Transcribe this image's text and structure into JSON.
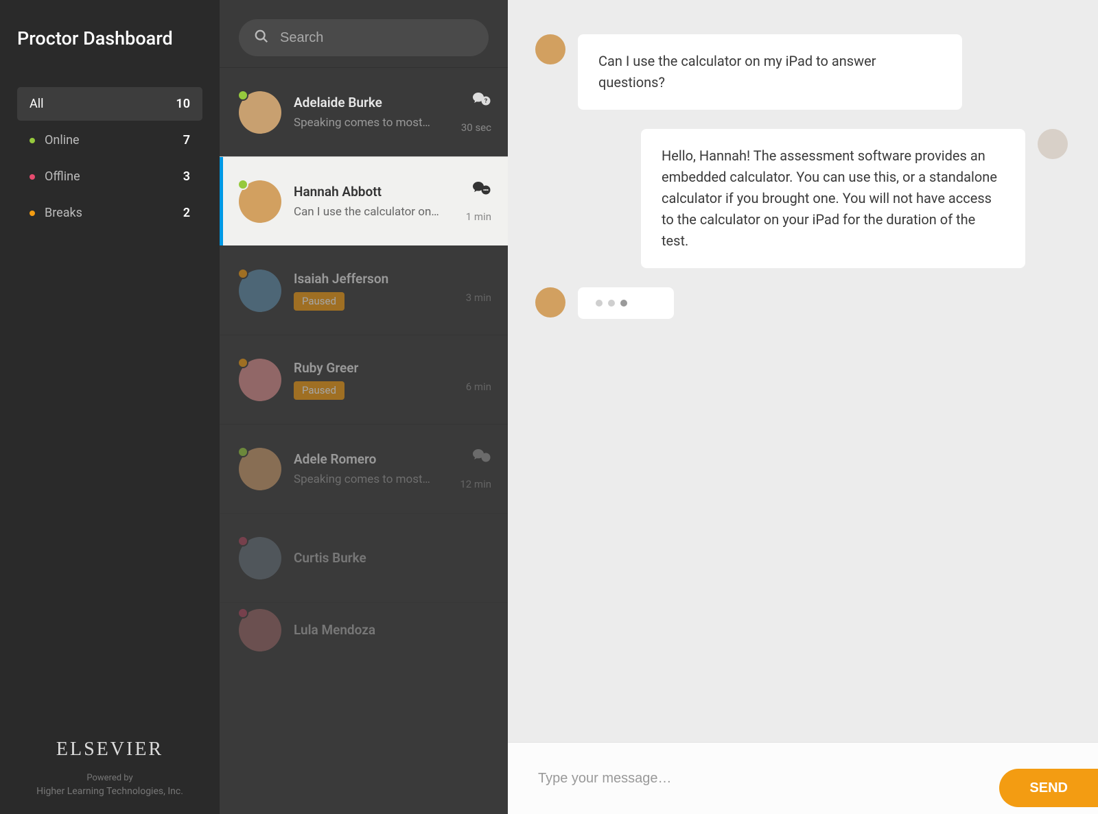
{
  "sidebar": {
    "title": "Proctor Dashboard",
    "filters": [
      {
        "label": "All",
        "count": "10",
        "status": "all",
        "active": true
      },
      {
        "label": "Online",
        "count": "7",
        "status": "online",
        "active": false
      },
      {
        "label": "Offline",
        "count": "3",
        "status": "offline",
        "active": false
      },
      {
        "label": "Breaks",
        "count": "2",
        "status": "break",
        "active": false
      }
    ],
    "brand": "ELSEVIER",
    "powered": "Powered by",
    "company": "Higher Learning Technologies, Inc."
  },
  "search": {
    "placeholder": "Search"
  },
  "students": [
    {
      "name": "Adelaide Burke",
      "preview": "Speaking comes to most…",
      "time": "30 sec",
      "status": "online",
      "chat": "question",
      "avatarColor": "#c8a070"
    },
    {
      "name": "Hannah Abbott",
      "preview": "Can I use the calculator on…",
      "time": "1 min",
      "status": "online",
      "chat": "active",
      "avatarColor": "#d2a060",
      "selected": true
    },
    {
      "name": "Isaiah Jefferson",
      "badge": "Paused",
      "time": "3 min",
      "status": "break",
      "avatarColor": "#5d8aa8"
    },
    {
      "name": "Ruby Greer",
      "badge": "Paused",
      "time": "6 min",
      "status": "break",
      "avatarColor": "#d98c8c"
    },
    {
      "name": "Adele Romero",
      "preview": "Speaking comes to most…",
      "time": "12 min",
      "status": "online",
      "chat": "muted",
      "avatarColor": "#c9996b"
    },
    {
      "name": "Curtis Burke",
      "status": "offline",
      "avatarColor": "#7a8a99"
    },
    {
      "name": "Lula Mendoza",
      "status": "offline",
      "avatarColor": "#c77b7b"
    }
  ],
  "chat": {
    "messages": [
      {
        "from": "student",
        "text": "Can I use the calculator on my iPad to answer questions?",
        "avatarColor": "#d2a060"
      },
      {
        "from": "proctor",
        "text": "Hello, Hannah!  The assessment software provides an embedded calculator. You can use this, or a standalone calculator if you brought one.  You will not have access to the calculator on your iPad for the duration of the test.",
        "avatarColor": "#d8d0c8"
      },
      {
        "from": "student",
        "typing": true,
        "avatarColor": "#d2a060"
      }
    ],
    "inputPlaceholder": "Type your message…",
    "sendLabel": "SEND"
  },
  "statusColors": {
    "online": "#96c93d",
    "offline": "#e74c6f",
    "break": "#f39c12"
  }
}
